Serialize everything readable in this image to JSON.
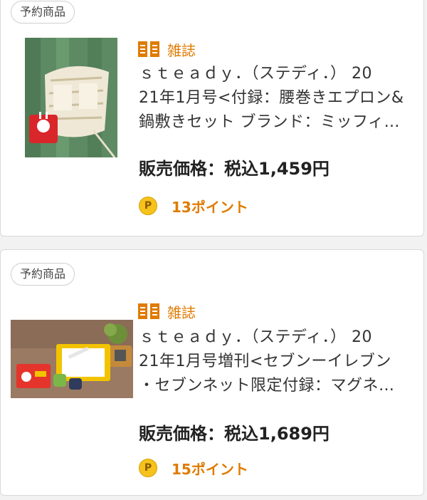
{
  "products": [
    {
      "badge": "予約商品",
      "category": "雑誌",
      "title_lines": [
        "ｓｔｅａｄｙ．（ステディ．） 20",
        "21年1月号<付録：腰巻きエプロン&",
        "鍋敷きセット ブランド：ミッフィ…"
      ],
      "price": "販売価格：税込1,459円",
      "points": "13ポイント",
      "image_icon": "magazine-apron-photo"
    },
    {
      "badge": "予約商品",
      "category": "雑誌",
      "title_lines": [
        "ｓｔｅａｄｙ．（ステディ．） 20",
        "21年1月号増刊<セブンーイレブン",
        "・セブンネット限定付録：マグネ…"
      ],
      "price": "販売価格：税込1,689円",
      "points": "15ポイント",
      "image_icon": "magazine-magnet-photo"
    }
  ],
  "point_icon_glyph": "P",
  "colors": {
    "accent_orange": "#e07b00",
    "point_gold": "#f6c21c"
  }
}
